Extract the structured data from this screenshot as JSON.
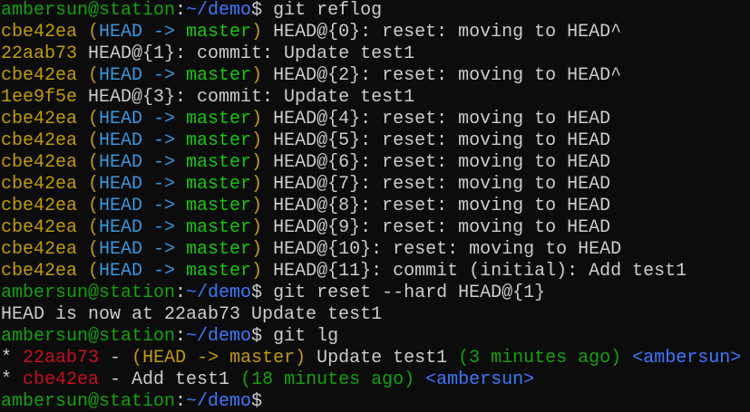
{
  "colors": {
    "background": "#0c0c0c",
    "default": "#cccccc",
    "prompt_user": "#13a10e",
    "prompt_path": "#3b78ff",
    "hash": "#c19c00",
    "head": "#3a96dd",
    "branch": "#16c60c",
    "paren": "#c19c00",
    "lg_hash": "#c50f1f",
    "lg_time": "#13a10e",
    "lg_author": "#3b78ff"
  },
  "terminal": {
    "lines": [
      {
        "segments": [
          {
            "text": "ambersun@station",
            "color": "prompt_user"
          },
          {
            "text": ":",
            "color": "default"
          },
          {
            "text": "~/demo",
            "color": "prompt_path"
          },
          {
            "text": "$ git reflog",
            "color": "default"
          }
        ]
      },
      {
        "segments": [
          {
            "text": "cbe42ea (",
            "color": "hash"
          },
          {
            "text": "HEAD -> ",
            "color": "head"
          },
          {
            "text": "master",
            "color": "branch"
          },
          {
            "text": ")",
            "color": "paren"
          },
          {
            "text": " HEAD@{0}: reset: moving to HEAD^",
            "color": "default"
          }
        ]
      },
      {
        "segments": [
          {
            "text": "22aab73",
            "color": "hash"
          },
          {
            "text": " HEAD@{1}: commit: Update test1",
            "color": "default"
          }
        ]
      },
      {
        "segments": [
          {
            "text": "cbe42ea (",
            "color": "hash"
          },
          {
            "text": "HEAD -> ",
            "color": "head"
          },
          {
            "text": "master",
            "color": "branch"
          },
          {
            "text": ")",
            "color": "paren"
          },
          {
            "text": " HEAD@{2}: reset: moving to HEAD^",
            "color": "default"
          }
        ]
      },
      {
        "segments": [
          {
            "text": "1ee9f5e",
            "color": "hash"
          },
          {
            "text": " HEAD@{3}: commit: Update test1",
            "color": "default"
          }
        ]
      },
      {
        "segments": [
          {
            "text": "cbe42ea (",
            "color": "hash"
          },
          {
            "text": "HEAD -> ",
            "color": "head"
          },
          {
            "text": "master",
            "color": "branch"
          },
          {
            "text": ")",
            "color": "paren"
          },
          {
            "text": " HEAD@{4}: reset: moving to HEAD",
            "color": "default"
          }
        ]
      },
      {
        "segments": [
          {
            "text": "cbe42ea (",
            "color": "hash"
          },
          {
            "text": "HEAD -> ",
            "color": "head"
          },
          {
            "text": "master",
            "color": "branch"
          },
          {
            "text": ")",
            "color": "paren"
          },
          {
            "text": " HEAD@{5}: reset: moving to HEAD",
            "color": "default"
          }
        ]
      },
      {
        "segments": [
          {
            "text": "cbe42ea (",
            "color": "hash"
          },
          {
            "text": "HEAD -> ",
            "color": "head"
          },
          {
            "text": "master",
            "color": "branch"
          },
          {
            "text": ")",
            "color": "paren"
          },
          {
            "text": " HEAD@{6}: reset: moving to HEAD",
            "color": "default"
          }
        ]
      },
      {
        "segments": [
          {
            "text": "cbe42ea (",
            "color": "hash"
          },
          {
            "text": "HEAD -> ",
            "color": "head"
          },
          {
            "text": "master",
            "color": "branch"
          },
          {
            "text": ")",
            "color": "paren"
          },
          {
            "text": " HEAD@{7}: reset: moving to HEAD",
            "color": "default"
          }
        ]
      },
      {
        "segments": [
          {
            "text": "cbe42ea (",
            "color": "hash"
          },
          {
            "text": "HEAD -> ",
            "color": "head"
          },
          {
            "text": "master",
            "color": "branch"
          },
          {
            "text": ")",
            "color": "paren"
          },
          {
            "text": " HEAD@{8}: reset: moving to HEAD",
            "color": "default"
          }
        ]
      },
      {
        "segments": [
          {
            "text": "cbe42ea (",
            "color": "hash"
          },
          {
            "text": "HEAD -> ",
            "color": "head"
          },
          {
            "text": "master",
            "color": "branch"
          },
          {
            "text": ")",
            "color": "paren"
          },
          {
            "text": " HEAD@{9}: reset: moving to HEAD",
            "color": "default"
          }
        ]
      },
      {
        "segments": [
          {
            "text": "cbe42ea (",
            "color": "hash"
          },
          {
            "text": "HEAD -> ",
            "color": "head"
          },
          {
            "text": "master",
            "color": "branch"
          },
          {
            "text": ")",
            "color": "paren"
          },
          {
            "text": " HEAD@{10}: reset: moving to HEAD",
            "color": "default"
          }
        ]
      },
      {
        "segments": [
          {
            "text": "cbe42ea (",
            "color": "hash"
          },
          {
            "text": "HEAD -> ",
            "color": "head"
          },
          {
            "text": "master",
            "color": "branch"
          },
          {
            "text": ")",
            "color": "paren"
          },
          {
            "text": " HEAD@{11}: commit (initial): Add test1",
            "color": "default"
          }
        ]
      },
      {
        "segments": [
          {
            "text": "ambersun@station",
            "color": "prompt_user"
          },
          {
            "text": ":",
            "color": "default"
          },
          {
            "text": "~/demo",
            "color": "prompt_path"
          },
          {
            "text": "$ git reset --hard HEAD@{1}",
            "color": "default"
          }
        ]
      },
      {
        "segments": [
          {
            "text": "HEAD is now at 22aab73 Update test1",
            "color": "default"
          }
        ]
      },
      {
        "segments": [
          {
            "text": "ambersun@station",
            "color": "prompt_user"
          },
          {
            "text": ":",
            "color": "default"
          },
          {
            "text": "~/demo",
            "color": "prompt_path"
          },
          {
            "text": "$ git lg",
            "color": "default"
          }
        ]
      },
      {
        "segments": [
          {
            "text": "* ",
            "color": "default"
          },
          {
            "text": "22aab73",
            "color": "lg_hash"
          },
          {
            "text": " - ",
            "color": "default"
          },
          {
            "text": "(",
            "color": "paren"
          },
          {
            "text": "HEAD -> ",
            "color": "paren"
          },
          {
            "text": "master",
            "color": "paren"
          },
          {
            "text": ")",
            "color": "paren"
          },
          {
            "text": " Update test1 ",
            "color": "default"
          },
          {
            "text": "(3 minutes ago)",
            "color": "lg_time"
          },
          {
            "text": " ",
            "color": "default"
          },
          {
            "text": "<ambersun>",
            "color": "lg_author"
          }
        ]
      },
      {
        "segments": [
          {
            "text": "* ",
            "color": "default"
          },
          {
            "text": "cbe42ea",
            "color": "lg_hash"
          },
          {
            "text": " - Add test1 ",
            "color": "default"
          },
          {
            "text": "(18 minutes ago)",
            "color": "lg_time"
          },
          {
            "text": " ",
            "color": "default"
          },
          {
            "text": "<ambersun>",
            "color": "lg_author"
          }
        ]
      },
      {
        "segments": [
          {
            "text": "ambersun@station",
            "color": "prompt_user"
          },
          {
            "text": ":",
            "color": "default"
          },
          {
            "text": "~/demo",
            "color": "prompt_path"
          },
          {
            "text": "$",
            "color": "default"
          }
        ]
      }
    ]
  }
}
